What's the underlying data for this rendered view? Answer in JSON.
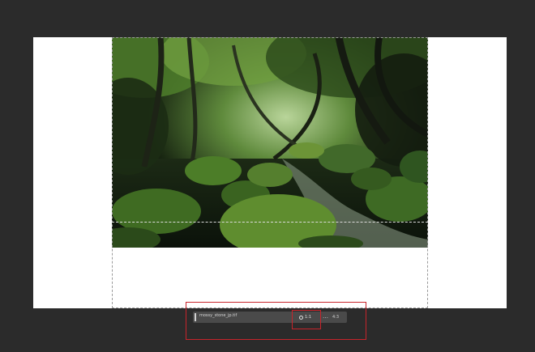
{
  "colors": {
    "workspace_bg": "#2b2b2b",
    "canvas_bg": "#ffffff",
    "toolbar_bg": "#4a4a4a",
    "highlight": "#c8242b"
  },
  "canvas": {
    "photo_name": "mossy-forest-stream",
    "photo_alt": "Mossy green boulders in a forest stream under a canopy of trees"
  },
  "bottom_bar": {
    "file_name": "mossy_stone_jp.tif",
    "ratio_icon": "rotate-icon",
    "ratio_label": "1:1",
    "more_label": "…",
    "swap_label": "4:3"
  }
}
